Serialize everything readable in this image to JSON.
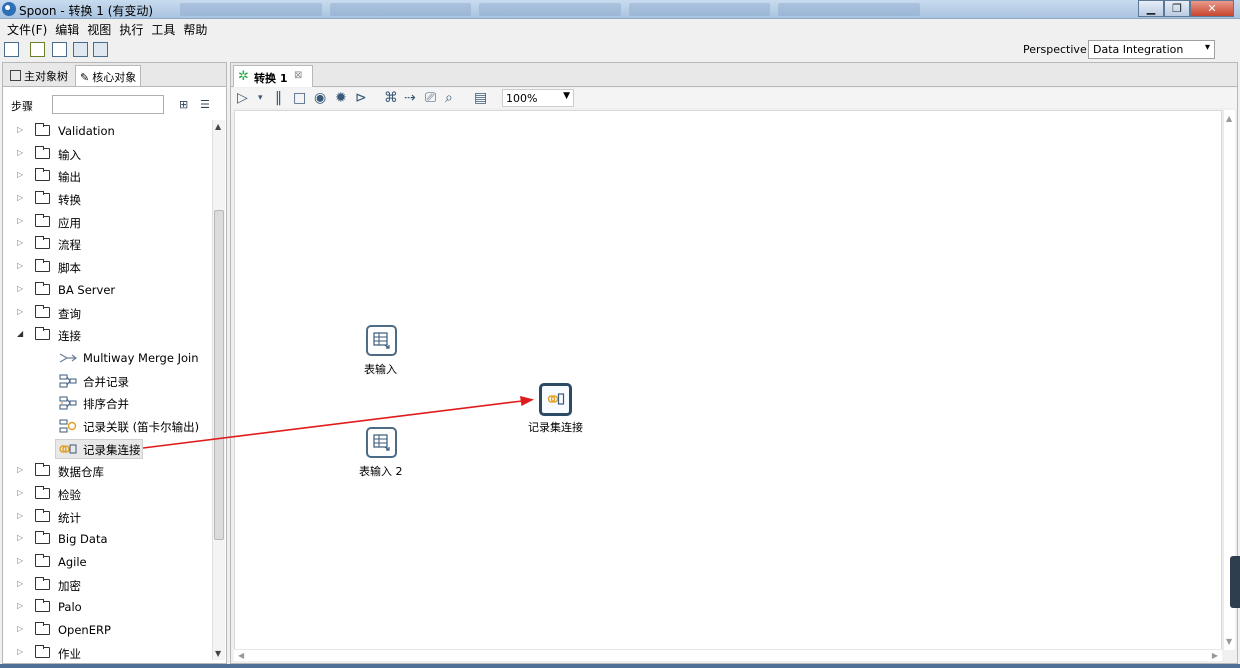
{
  "window": {
    "title": "Spoon - 转换 1 (有变动)"
  },
  "menu": [
    "文件(F)",
    "编辑",
    "视图",
    "执行",
    "工具",
    "帮助"
  ],
  "perspective": {
    "label": "Perspective:",
    "value": "Data Integration"
  },
  "left_panel": {
    "tabs": [
      "主对象树",
      "核心对象"
    ],
    "active_tab": "核心对象",
    "steps_label": "步骤",
    "search_value": "",
    "tree": [
      {
        "label": "Validation",
        "type": "folder",
        "expanded": false
      },
      {
        "label": "输入",
        "type": "folder",
        "expanded": false
      },
      {
        "label": "输出",
        "type": "folder",
        "expanded": false
      },
      {
        "label": "转换",
        "type": "folder",
        "expanded": false
      },
      {
        "label": "应用",
        "type": "folder",
        "expanded": false
      },
      {
        "label": "流程",
        "type": "folder",
        "expanded": false
      },
      {
        "label": "脚本",
        "type": "folder",
        "expanded": false
      },
      {
        "label": "BA Server",
        "type": "folder",
        "expanded": false
      },
      {
        "label": "查询",
        "type": "folder",
        "expanded": false
      },
      {
        "label": "连接",
        "type": "folder",
        "expanded": true
      },
      {
        "label": "Multiway Merge Join",
        "type": "step",
        "icon": "multiway-merge-join-icon"
      },
      {
        "label": "合并记录",
        "type": "step",
        "icon": "merge-rows-icon"
      },
      {
        "label": "排序合并",
        "type": "step",
        "icon": "sorted-merge-icon"
      },
      {
        "label": "记录关联 (笛卡尔输出)",
        "type": "step",
        "icon": "join-rows-icon"
      },
      {
        "label": "记录集连接",
        "type": "step",
        "icon": "merge-join-icon",
        "highlight": true
      },
      {
        "label": "数据仓库",
        "type": "folder",
        "expanded": false
      },
      {
        "label": "检验",
        "type": "folder",
        "expanded": false
      },
      {
        "label": "统计",
        "type": "folder",
        "expanded": false
      },
      {
        "label": "Big Data",
        "type": "folder",
        "expanded": false
      },
      {
        "label": "Agile",
        "type": "folder",
        "expanded": false
      },
      {
        "label": "加密",
        "type": "folder",
        "expanded": false
      },
      {
        "label": "Palo",
        "type": "folder",
        "expanded": false
      },
      {
        "label": "OpenERP",
        "type": "folder",
        "expanded": false
      },
      {
        "label": "作业",
        "type": "folder",
        "expanded": false
      }
    ]
  },
  "workspace": {
    "tab_label": "转换 1",
    "zoom": "100%",
    "nodes": [
      {
        "id": "table-input-1",
        "label": "表输入"
      },
      {
        "id": "table-input-2",
        "label": "表输入 2"
      },
      {
        "id": "merge-join",
        "label": "记录集连接"
      }
    ]
  }
}
